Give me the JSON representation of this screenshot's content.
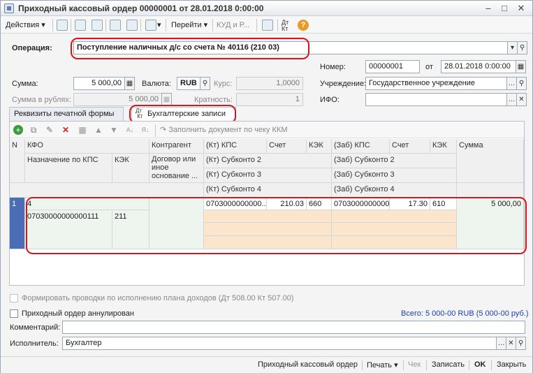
{
  "window": {
    "title": "Приходный кассовый ордер 00000001 от 28.01.2018 0:00:00"
  },
  "toolbar": {
    "actions": "Действия",
    "goto": "Перейти",
    "kud": "КУД и Р..."
  },
  "operation": {
    "label": "Операция:",
    "value": "Поступление наличных д/с со счета № 40116 (210 03)"
  },
  "number": {
    "label": "Номер:",
    "value": "00000001",
    "ot": "от",
    "date": "28.01.2018  0:00:00"
  },
  "sum": {
    "label": "Сумма:",
    "value": "5 000,00",
    "currency_label": "Валюта:",
    "currency": "RUB",
    "rate_label": "Курс:",
    "rate": "1,0000"
  },
  "sum_rub": {
    "label": "Сумма в рублях:",
    "value": "5 000,00",
    "mult_label": "Кратность:",
    "mult": "1"
  },
  "institution": {
    "label": "Учреждение:",
    "value": "Государственное учреждение"
  },
  "ifo": {
    "label": "ИФО:",
    "value": ""
  },
  "tabs": [
    {
      "label": "Реквизиты печатной формы"
    },
    {
      "label": "Бухгалтерские записи"
    }
  ],
  "tabicon": {
    "top": "Дт",
    "bottom": "Кт"
  },
  "panel_toolbar": {
    "fill_label": "Заполнить документ по чеку ККМ"
  },
  "grid": {
    "headers": {
      "n": "N",
      "kfo": "КФО",
      "naznachenie": "Назначение по КПС",
      "kek": "КЭК",
      "kontragent": "Контрагент",
      "dogovor": "Договор или иное основание ...",
      "kt_kps": "(Кт) КПС",
      "schet": "Счет",
      "kek2": "КЭК",
      "zab_kps": "(Заб) КПС",
      "schet2": "Счет",
      "kek3": "КЭК",
      "summa": "Сумма",
      "kt_sub2": "(Кт) Субконто 2",
      "kt_sub3": "(Кт) Субконто 3",
      "kt_sub4": "(Кт) Субконто 4",
      "zab_sub2": "(Заб) Субконто 2",
      "zab_sub3": "(Заб) Субконто 3",
      "zab_sub4": "(Заб) Субконто 4"
    },
    "row": {
      "n": "1",
      "kfo": "4",
      "naznachenie": "07030000000000111",
      "kek": "211",
      "kt_kps": "0703000000000...",
      "schet": "210.03",
      "kek2": "660",
      "zab_kps": "0703000000000...",
      "schet2": "17.30",
      "kek3": "610",
      "summa": "5 000,00"
    }
  },
  "form_postings": {
    "label": "Формировать проводки по исполнению плана доходов (Дт 508.00 Кт 507.00)"
  },
  "annulled": {
    "label": "Приходный ордер аннулирован"
  },
  "total": {
    "text": "Всего: 5 000-00 RUB (5 000-00 руб.)"
  },
  "comment": {
    "label": "Комментарий:",
    "value": ""
  },
  "executor": {
    "label": "Исполнитель:",
    "value": "Бухгалтер"
  },
  "statusbar": {
    "pko": "Приходный кассовый ордер",
    "print": "Печать",
    "check": "Чек",
    "save": "Записать",
    "ok": "OK",
    "close": "Закрыть"
  },
  "colors": {
    "accent": "#4a6db5",
    "highlight": "#d9141b",
    "orange": "#fbe5cc",
    "total_text": "#1a3fb0"
  }
}
